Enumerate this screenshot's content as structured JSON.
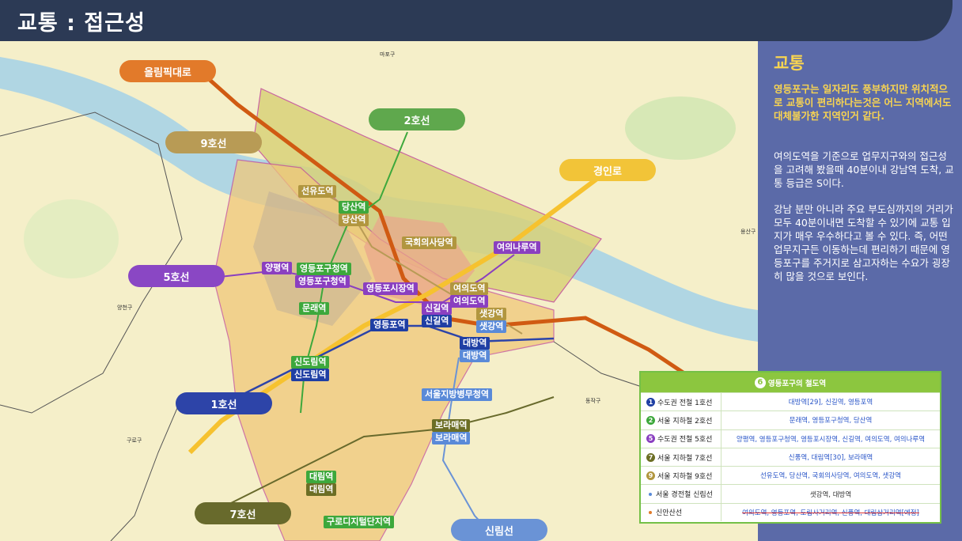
{
  "header": {
    "title": "교통 : 접근성"
  },
  "roads": [
    {
      "label": "올림픽대로",
      "color": "#e27a2a"
    },
    {
      "label": "9호선",
      "color": "#b89b55"
    },
    {
      "label": "2호선",
      "color": "#5fa84d"
    },
    {
      "label": "경인로",
      "color": "#f2c438"
    },
    {
      "label": "5호선",
      "color": "#8a47c4"
    },
    {
      "label": "1호선",
      "color": "#2d44a8"
    },
    {
      "label": "7호선",
      "color": "#686a2c"
    },
    {
      "label": "신림선",
      "color": "#6a93d6"
    }
  ],
  "stations": {
    "seonyudo": "선유도역",
    "dangsan1": "당산역",
    "dangsan2": "당산역",
    "gukhoe": "국회의사당역",
    "yeouinaru": "여의나루역",
    "yangpyeong": "양평역",
    "ydpgucheong1": "영등포구청역",
    "ydpgucheong2": "영등포구청역",
    "ydpsijang": "영등포시장역",
    "yeouido1": "여의도역",
    "yeouido2": "여의도역",
    "mullae": "문래역",
    "singil1": "신길역",
    "singil2": "신길역",
    "saetgang1": "샛강역",
    "saetgang2": "샛강역",
    "yeongdeungpo": "영등포역",
    "daebang1": "대방역",
    "daebang2": "대방역",
    "sindorim1": "신도림역",
    "sindorim2": "신도림역",
    "byeongmu": "서울지방병무청역",
    "boramae1": "보라매역",
    "boramae2": "보라매역",
    "daerim1": "대림역",
    "daerim2": "대림역",
    "gurodigital": "구로디지털단지역"
  },
  "map_places": {
    "mapo": "마포구",
    "yangcheon": "양천구",
    "guro": "구로구",
    "dongjak": "동작구",
    "yongsan": "용산구"
  },
  "sidebar": {
    "title": "교통",
    "highlight": "영등포구는 일자리도 풍부하지만 위치적으로 교통이 편리하다는것은 어느 지역에서도 대체불가한 지역인거 같다.",
    "p1": "여의도역을 기준으로 업무지구와의 접근성을 고려해 봤을때 40분이내 강남역 도착, 교통 등급은 S이다.",
    "p2": "강남 분만 아니라 주요 부도심까지의 거리가 모두 40분이내면 도착할 수 있기에 교통 입지가 매우 우수하다고 볼 수 있다. 즉, 어떤 업무지구든 이동하는데 편리하기 때문에 영등포구를 주거지로 삼고자하는 수요가 굉장히 많을 것으로 보인다."
  },
  "table": {
    "header_num": "6",
    "header": "영등포구의 철도역",
    "rows": [
      {
        "badge": "1",
        "color": "#1f3fa4",
        "label": "수도권 전철 1호선",
        "value": "대방역[29], 신길역, 영등포역",
        "style": "link"
      },
      {
        "badge": "2",
        "color": "#3da83c",
        "label": "서울 지하철 2호선",
        "value": "문래역, 영등포구청역, 당산역",
        "style": "link"
      },
      {
        "badge": "5",
        "color": "#8a3fc0",
        "label": "수도권 전철 5호선",
        "value": "양평역, 영등포구청역, 영등포시장역, 신길역, 여의도역, 여의나루역",
        "style": "link"
      },
      {
        "badge": "7",
        "color": "#6c6e25",
        "label": "서울 지하철 7호선",
        "value": "신풍역, 대림역[30], 보라매역",
        "style": "link"
      },
      {
        "badge": "9",
        "color": "#b1963f",
        "label": "서울 지하철 9호선",
        "value": "선유도역, 당산역, 국회의사당역, 여의도역, 샛강역",
        "style": "link"
      },
      {
        "badge": "",
        "color": "#5a8ad8",
        "label": "서울 경전철 신림선",
        "value": "샛강역, 대방역",
        "style": "plain"
      },
      {
        "badge": "",
        "color": "#e07a2a",
        "label": "신안산선",
        "value": "여의도역, 영등포역, 도림사거리역, 신풍역, 대림삼거리역[예정]",
        "style": "strike"
      }
    ]
  }
}
